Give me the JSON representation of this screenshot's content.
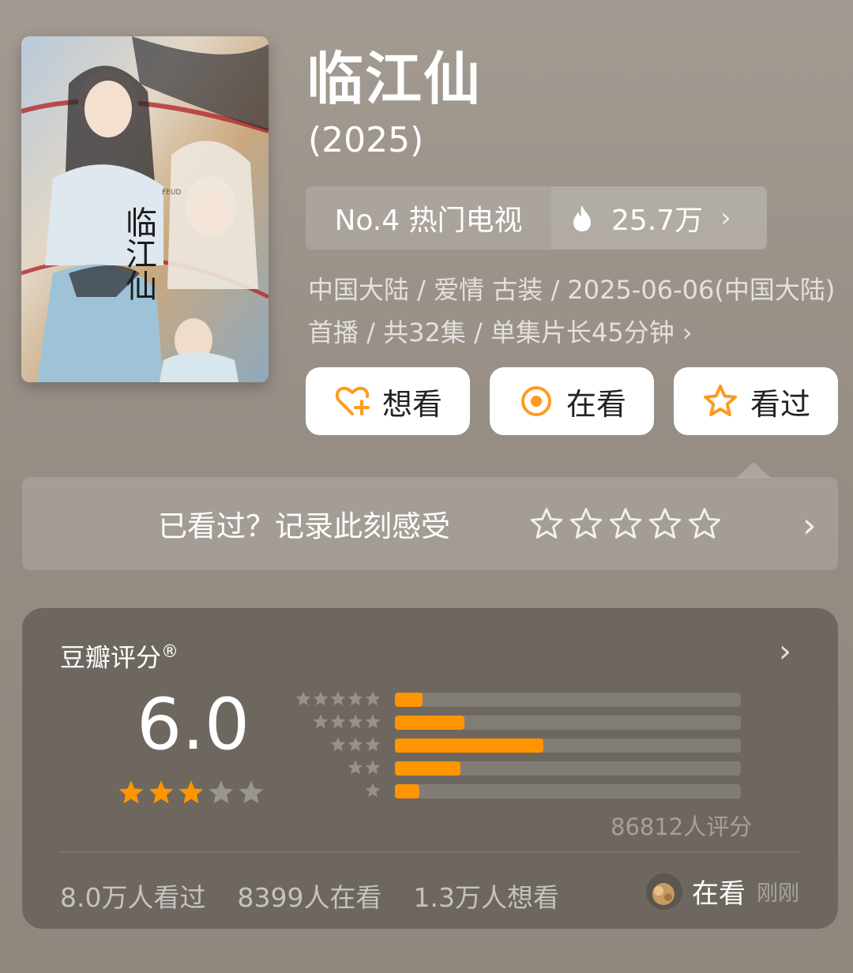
{
  "show": {
    "title": "临江仙",
    "year": "(2025)",
    "rank_label": "No.4 热门电视",
    "heat_value": "25.7万",
    "meta": "中国大陆 / 爱情 古装 / 2025-06-06(中国大陆)首播 / 共32集 / 单集片长45分钟 ›"
  },
  "poster": {
    "title_text": "临江仙",
    "subtitle_text": "FEUD"
  },
  "actions": {
    "want": "想看",
    "watching": "在看",
    "watched": "看过"
  },
  "record": {
    "prompt": "已看过？记录此刻感受",
    "stars_total": 5
  },
  "rating": {
    "label": "豆瓣评分",
    "reg_mark": "®",
    "score": "6.0",
    "stars_filled": 3,
    "stars_total": 5,
    "distribution": [
      {
        "stars": 5,
        "fraction": 0.08
      },
      {
        "stars": 4,
        "fraction": 0.2
      },
      {
        "stars": 3,
        "fraction": 0.43
      },
      {
        "stars": 2,
        "fraction": 0.19
      },
      {
        "stars": 1,
        "fraction": 0.07
      }
    ],
    "count_text": "86812人评分",
    "watched_text": "8.0万人看过",
    "watching_text": "8399人在看",
    "want_text": "1.3万人想看",
    "friend_status": "在看",
    "friend_time": "刚刚"
  },
  "colors": {
    "accent": "#ff9500",
    "card_bg": "#6e6760",
    "page_bg": "#9a9289"
  }
}
